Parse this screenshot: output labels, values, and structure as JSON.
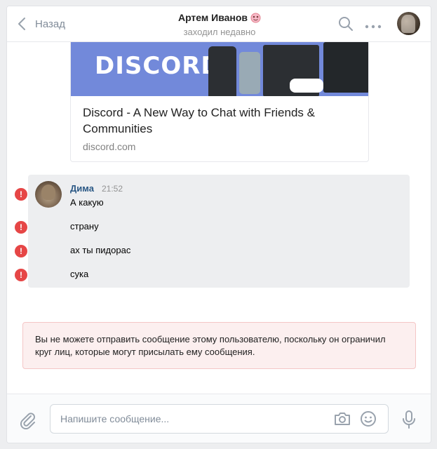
{
  "header": {
    "back_label": "Назад",
    "contact_name": "Артем Иванов",
    "contact_status": "заходил недавно"
  },
  "link_card": {
    "logo_text": "DISCORD",
    "title": "Discord - A New Way to Chat with Friends & Communities",
    "domain": "discord.com"
  },
  "message_group": {
    "author": "Дима",
    "time": "21:52",
    "messages": [
      "А какую",
      "страну",
      "ах ты пидорас",
      "сука"
    ]
  },
  "notice": {
    "text": "Вы не можете отправить сообщение этому пользователю, поскольку он ограничил круг лиц, которые могут присылать ему сообщения."
  },
  "composer": {
    "placeholder": "Напишите сообщение..."
  },
  "colors": {
    "accent_link": "#2a5885",
    "error": "#e64646",
    "discord_brand": "#7289da",
    "notice_bg": "#fcefef"
  }
}
